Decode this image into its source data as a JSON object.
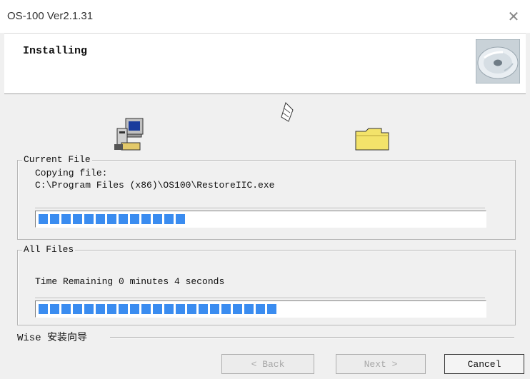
{
  "window": {
    "title": "OS-100 Ver2.1.31",
    "close_symbol": "✕"
  },
  "header": {
    "title": "Installing",
    "icon": "disc-icon"
  },
  "icons": [
    "computer-install-icon",
    "paper-icon",
    "folder-icon"
  ],
  "current_file": {
    "legend": "Current File",
    "line1": "Copying file:",
    "line2": "C:\\Program Files (x86)\\OS100\\RestoreIIC.exe",
    "progress_fraction": 0.33
  },
  "all_files": {
    "legend": "All Files",
    "status": "Time Remaining 0 minutes 4 seconds",
    "progress_fraction": 0.55
  },
  "footer": {
    "brand": "Wise 安装向导"
  },
  "buttons": {
    "back": "< Back",
    "next": "Next >",
    "cancel": "Cancel"
  },
  "colors": {
    "progress": "#3a8cf0",
    "folder": "#f3e36a"
  }
}
